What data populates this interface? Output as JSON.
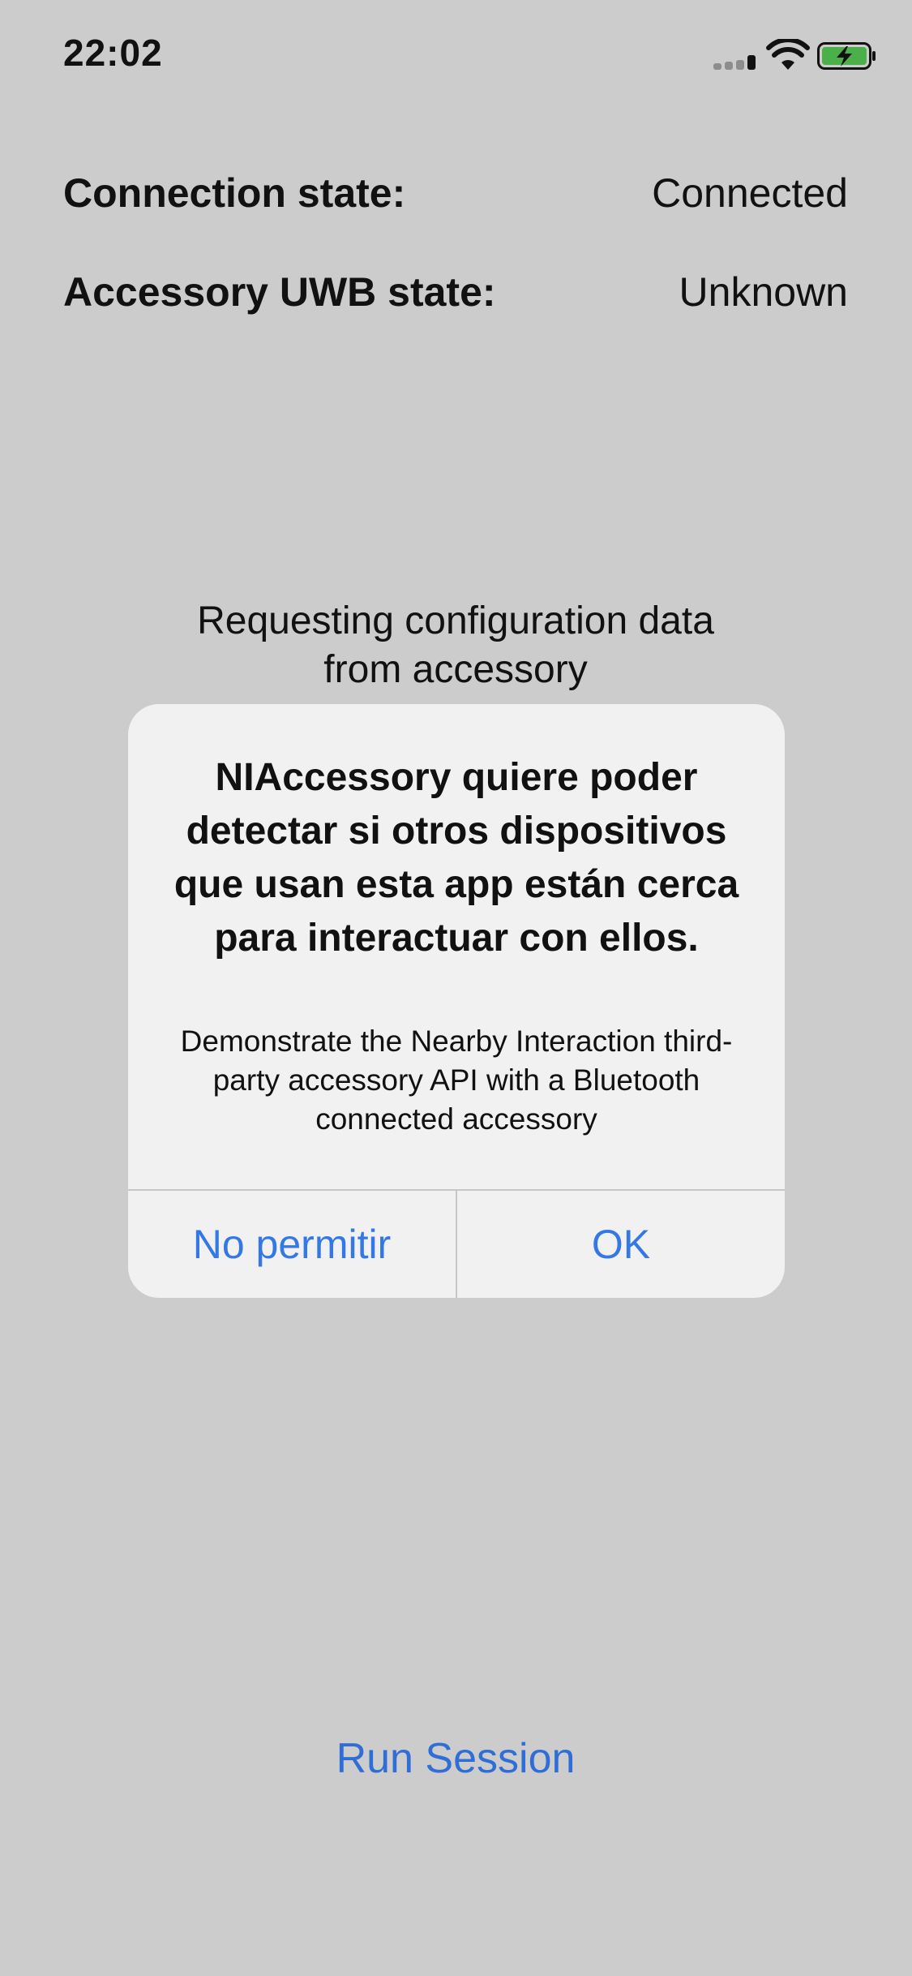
{
  "status_bar": {
    "time": "22:02",
    "icons": [
      "cellular-signal-icon",
      "wifi-icon",
      "battery-charging-icon"
    ]
  },
  "info": {
    "connection_label": "Connection state:",
    "connection_value": "Connected",
    "uwb_label": "Accessory UWB state:",
    "uwb_value": "Unknown"
  },
  "main": {
    "requesting_line1": "Requesting configuration data",
    "requesting_line2": "from accessory",
    "run_session_label": "Run Session"
  },
  "alert": {
    "title": "NIAccessory quiere poder detectar si otros dispositivos que usan esta app están cerca para interactuar con ellos.",
    "message": "Demonstrate the Nearby Interaction third-party accessory API with a Bluetooth connected accessory",
    "deny_label": "No permitir",
    "ok_label": "OK"
  },
  "colors": {
    "background": "#cccccc",
    "alert_background": "#f1f1f1",
    "accent": "#3478e6",
    "battery_fill": "#4cb04a"
  }
}
